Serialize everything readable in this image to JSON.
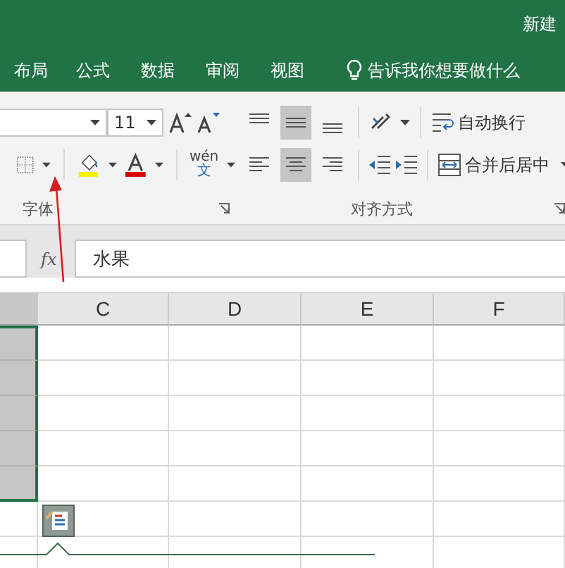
{
  "title_bar": {
    "text": "新建"
  },
  "tabs": [
    {
      "label": "布局",
      "selected": false
    },
    {
      "label": "公式",
      "selected": false
    },
    {
      "label": "数据",
      "selected": false
    },
    {
      "label": "审阅",
      "selected": false
    },
    {
      "label": "视图",
      "selected": false
    }
  ],
  "tell_me": {
    "placeholder": "告诉我你想要做什么"
  },
  "font_group": {
    "font_size": "11",
    "phonetic_top": "wén",
    "phonetic_bottom": "文",
    "label": "字体"
  },
  "align_group": {
    "buttons": [
      {
        "kind": "top",
        "selected": false
      },
      {
        "kind": "middle",
        "selected": true
      },
      {
        "kind": "bottom",
        "selected": false
      },
      {
        "kind": "left",
        "selected": false
      },
      {
        "kind": "center",
        "selected": true
      },
      {
        "kind": "right",
        "selected": false
      }
    ],
    "wrap_text": "自动换行",
    "merge_center": "合并后居中",
    "label": "对齐方式"
  },
  "formula_bar": {
    "fx": "fx",
    "value": "水果"
  },
  "sheet": {
    "columns": [
      {
        "selected": true
      },
      {
        "label": "C",
        "selected": false
      },
      {
        "label": "D",
        "selected": false
      },
      {
        "label": "E",
        "selected": false
      },
      {
        "label": "F",
        "selected": false
      }
    ],
    "rows": [
      {
        "selected": true
      },
      {
        "selected": true
      },
      {
        "selected": true
      },
      {
        "selected": true
      },
      {
        "selected": true
      },
      {
        "selected": false
      },
      {
        "selected": false
      }
    ]
  }
}
